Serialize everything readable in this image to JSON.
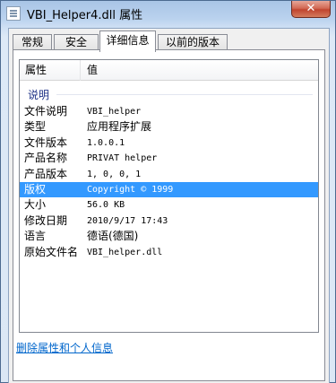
{
  "window": {
    "title": "VBI_Helper4.dll 属性",
    "close_label": "✕"
  },
  "tabs": [
    {
      "label": "常规",
      "active": false
    },
    {
      "label": "安全",
      "active": false
    },
    {
      "label": "详细信息",
      "active": true
    },
    {
      "label": "以前的版本",
      "active": false
    }
  ],
  "list": {
    "columns": {
      "property": "属性",
      "value": "值"
    },
    "group": "说明",
    "rows": [
      {
        "property": "文件说明",
        "value": "VBI_helper"
      },
      {
        "property": "类型",
        "value": "应用程序扩展"
      },
      {
        "property": "文件版本",
        "value": "1.0.0.1"
      },
      {
        "property": "产品名称",
        "value": "PRIVAT helper"
      },
      {
        "property": "产品版本",
        "value": "1, 0, 0, 1"
      },
      {
        "property": "版权",
        "value": "Copyright © 1999",
        "selected": true
      },
      {
        "property": "大小",
        "value": "56.0 KB"
      },
      {
        "property": "修改日期",
        "value": "2010/9/17 17:43"
      },
      {
        "property": "语言",
        "value": "德语(德国)"
      },
      {
        "property": "原始文件名",
        "value": "VBI_helper.dll"
      }
    ]
  },
  "links": {
    "remove_properties": "删除属性和个人信息"
  },
  "colors": {
    "selection": "#3399ff",
    "group_header": "#1e3287",
    "link": "#0066cc"
  }
}
